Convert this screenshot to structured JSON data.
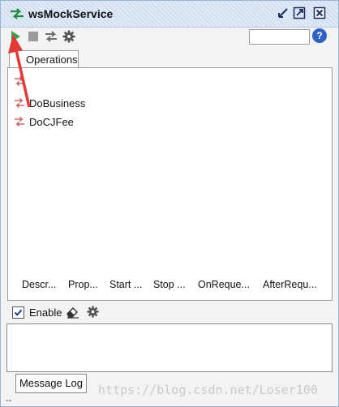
{
  "window": {
    "title": "wsMockService"
  },
  "toolbar": {
    "search_value": "",
    "help_label": "?"
  },
  "tabs": [
    {
      "label": "Operations"
    }
  ],
  "operations": [
    {
      "label": "DoBusiness"
    },
    {
      "label": "DoCJFee"
    }
  ],
  "column_headers": [
    {
      "label": "Descr..."
    },
    {
      "label": "Prop..."
    },
    {
      "label": "Start ..."
    },
    {
      "label": "Stop ..."
    },
    {
      "label": "OnReque..."
    },
    {
      "label": "AfterRequ..."
    }
  ],
  "enable": {
    "label": "Enable",
    "checked": true
  },
  "message_log": {
    "label": "Message Log"
  },
  "status": {
    "text": "--"
  },
  "watermark": "https://blog.csdn.net/Loser100",
  "colors": {
    "run_green": "#2fa84f",
    "annotation_red": "#e53935",
    "help_blue": "#2a62c8"
  }
}
